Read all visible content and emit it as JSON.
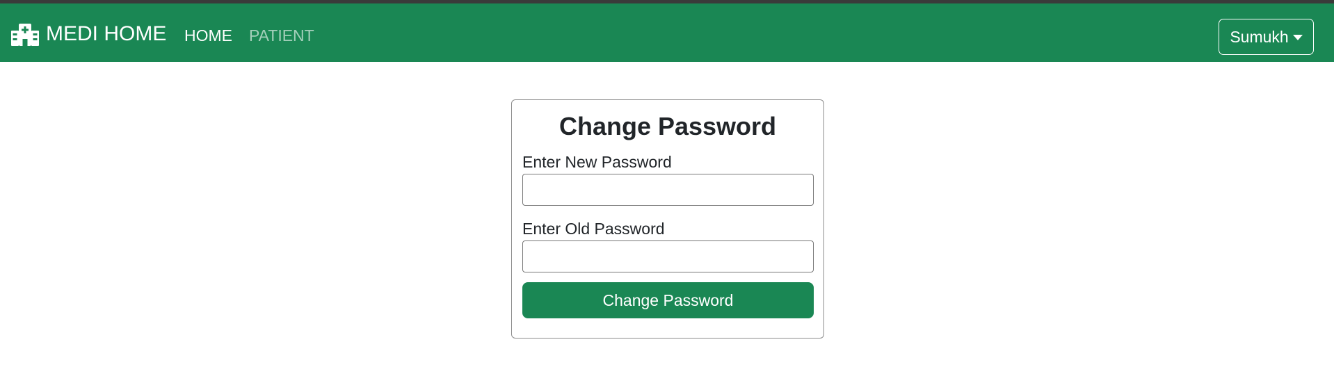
{
  "navbar": {
    "background_color": "#1a8754",
    "brand": {
      "icon": "hospital-icon",
      "text": "MEDI HOME"
    },
    "links": [
      {
        "label": "HOME",
        "active": true
      },
      {
        "label": "PATIENT",
        "active": false
      }
    ],
    "user_menu": {
      "label": "Sumukh",
      "icon": "caret-down-icon"
    }
  },
  "form": {
    "title": "Change Password",
    "new_password": {
      "label": "Enter New Password",
      "value": ""
    },
    "old_password": {
      "label": "Enter Old Password",
      "value": ""
    },
    "submit_label": "Change Password",
    "button_color": "#1a8754"
  }
}
